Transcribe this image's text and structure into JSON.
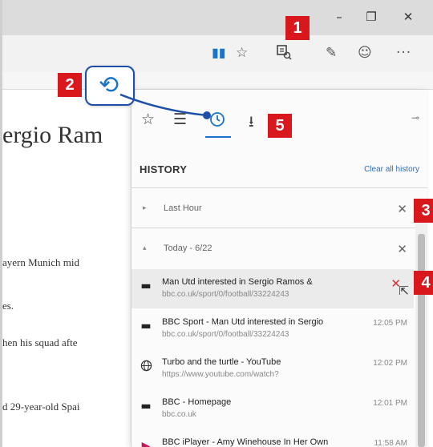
{
  "window_controls": {
    "minimize": "–",
    "restore": "❐",
    "close": "✕"
  },
  "toolbar": {
    "reading_view_icon": "book-icon",
    "favorite_icon": "star-icon",
    "hub_icon": "hub-icon",
    "note_icon": "pen-note-icon",
    "feedback_icon": "smiley-icon",
    "more": "···"
  },
  "page": {
    "title": "ergio Ram",
    "lines": [
      "ayern Munich mid",
      "es.",
      "hen his squad afte",
      "d 29-year-old Spai"
    ]
  },
  "hub": {
    "tabs": [
      "favorites-icon",
      "reading-list-icon",
      "history-icon",
      "downloads-icon"
    ],
    "active_tab": "history",
    "heading": "HISTORY",
    "clear_all": "Clear all history",
    "groups": [
      {
        "label": "Last Hour",
        "expanded": false
      },
      {
        "label": "Today - 6/22",
        "expanded": true
      }
    ],
    "items": [
      {
        "title": "Man Utd interested in Sergio Ramos &",
        "url": "bbc.co.uk/sport/0/football/33224243",
        "time": "",
        "favicon": "bbc-icon",
        "hover": true
      },
      {
        "title": "BBC Sport - Man Utd interested in Sergio",
        "url": "bbc.co.uk/sport/0/football/33224243",
        "time": "12:05 PM",
        "favicon": "bbc-icon",
        "hover": false
      },
      {
        "title": "Turbo and the turtle - YouTube",
        "url": "https://www.youtube.com/watch?",
        "time": "12:02 PM",
        "favicon": "globe-icon",
        "hover": false
      },
      {
        "title": "BBC - Homepage",
        "url": "bbc.co.uk",
        "time": "12:01 PM",
        "favicon": "bbc-icon",
        "hover": false
      },
      {
        "title": "BBC iPlayer - Amy Winehouse In Her Own",
        "url": "",
        "time": "11:58 AM",
        "favicon": "iplayer-icon",
        "hover": false
      }
    ]
  },
  "callouts": [
    "1",
    "2",
    "3",
    "4",
    "5"
  ],
  "colors": {
    "accent": "#1a73c8",
    "callout": "#d9181e",
    "connector": "#1e4fa8",
    "delete": "#d13438"
  }
}
